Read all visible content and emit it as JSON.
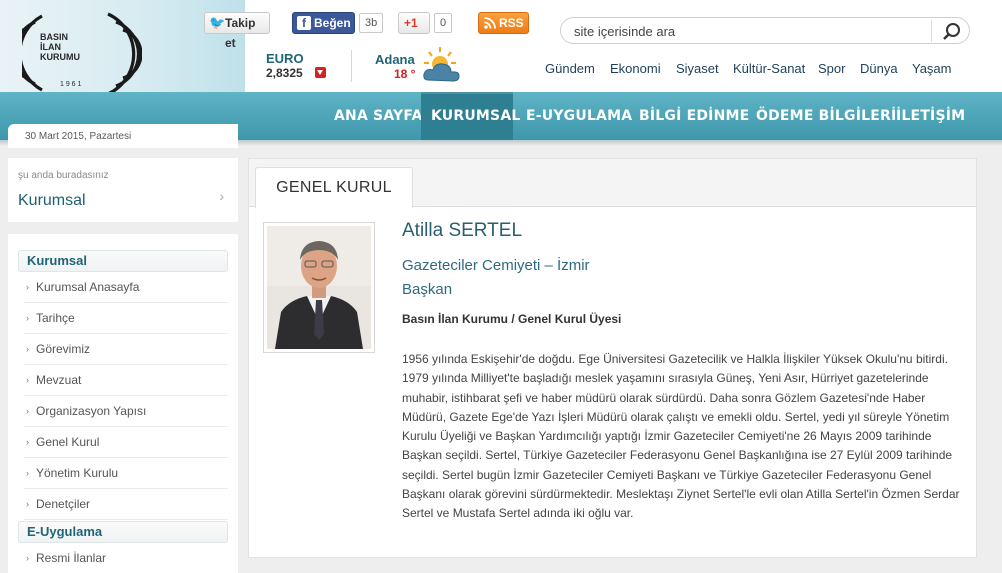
{
  "logo": {
    "lines": [
      "BASIN",
      "İLAN",
      "KURUMU"
    ],
    "year": "1 9 6 1"
  },
  "social": {
    "twitter_label": "Takip et",
    "facebook_label": "Beğen",
    "facebook_count": "3b",
    "gplus_label": "+1",
    "gplus_count": "0",
    "rss_label": "RSS"
  },
  "currency": {
    "label": "EURO",
    "value": "2,8325",
    "trend_icon": "down-arrow-icon",
    "trend_color": "#d32222"
  },
  "weather": {
    "city": "Adana",
    "temperature": "18 °",
    "icon": "sun-cloud-icon"
  },
  "search": {
    "placeholder": "site içerisinde ara",
    "icon": "search-icon"
  },
  "top_nav": [
    "Gündem",
    "Ekonomi",
    "Siyaset",
    "Kültür-Sanat",
    "Spor",
    "Dünya",
    "Yaşam"
  ],
  "main_nav": [
    {
      "label": "ANA SAYFA",
      "active": false
    },
    {
      "label": "KURUMSAL",
      "active": true
    },
    {
      "label": "E-UYGULAMA",
      "active": false
    },
    {
      "label": "BİLGİ EDİNME",
      "active": false
    },
    {
      "label": "ÖDEME BİLGİLERİ",
      "active": false
    },
    {
      "label": "İLETİŞİM",
      "active": false
    }
  ],
  "date": "30 Mart 2015, Pazartesi",
  "breadcrumb": {
    "label": "şu anda buradasınız",
    "current": "Kurumsal"
  },
  "sidebar": {
    "section1": "Kurumsal",
    "items": [
      "Kurumsal Anasayfa",
      "Tarihçe",
      "Görevimiz",
      "Mevzuat",
      "Organizasyon Yapısı",
      "Genel Kurul",
      "Yönetim Kurulu",
      "Denetçiler"
    ],
    "section2": "E-Uygulama",
    "items2": [
      "Resmi İlanlar"
    ]
  },
  "content": {
    "tab": "GENEL KURUL",
    "name": "Atilla SERTEL",
    "organization": "Gazeteciler Cemiyeti – İzmir",
    "role": "Başkan",
    "title": "Basın İlan Kurumu / Genel Kurul Üyesi",
    "bio": "1956 yılında Eskişehir'de doğdu. Ege Üniversitesi Gazetecilik ve Halkla İlişkiler Yüksek Okulu'nu bitirdi. 1979 yılında Milliyet'te başladığı meslek yaşamını sırasıyla Güneş, Yeni Asır, Hürriyet gazetelerinde muhabir, istihbarat şefi ve haber müdürü olarak sürdürdü. Daha sonra Gözlem Gazetesi'nde Haber Müdürü, Gazete Ege'de Yazı İşleri Müdürü olarak çalıştı ve emekli oldu. Sertel, yedi yıl süreyle Yönetim Kurulu Üyeliği ve Başkan Yardımcılığı yaptığı İzmir Gazeteciler Cemiyeti'ne 26 Mayıs 2009 tarihinde Başkan seçildi. Sertel, Türkiye Gazeteciler Federasyonu Genel Başkanlığına ise 27 Eylül 2009 tarihinde seçildi. Sertel bugün İzmir Gazeteciler Cemiyeti Başkanı ve Türkiye Gazeteciler Federasyonu Genel Başkanı olarak görevini sürdürmektedir. Meslektaşı Ziynet Sertel'le evli olan Atilla Sertel'in Özmen Serdar Sertel ve Mustafa Sertel adında iki oğlu var."
  },
  "colors": {
    "accent": "#3f97ab",
    "accent_dark": "#2e7f92",
    "link": "#1f6477"
  }
}
